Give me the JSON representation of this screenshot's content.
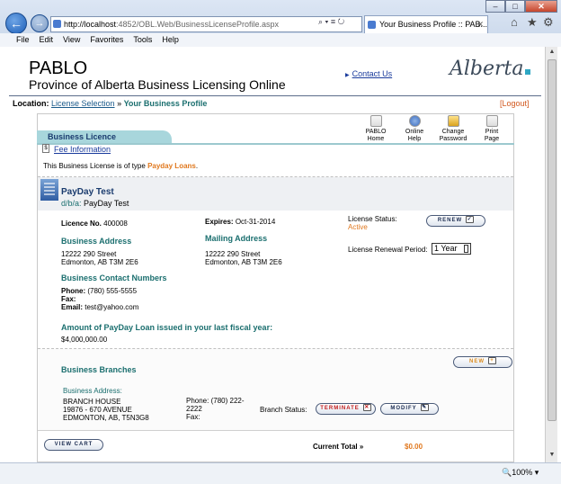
{
  "browser": {
    "title_buttons": [
      "–",
      "□",
      "✕"
    ],
    "back_icon": "back-arrow-icon",
    "forward_icon": "forward-arrow-icon",
    "address_host": "http://localhost",
    "address_rest": ":4852/OBL.Web/BusinessLicenseProfile.aspx",
    "address_tools": "⌕ ▾ ≡ ↻",
    "tab_title": "Your Business Profile :: PAB...",
    "tab_close": "✕",
    "toolbar_icons": [
      "⌂",
      "★",
      "⚙"
    ],
    "menu": [
      "File",
      "Edit",
      "View",
      "Favorites",
      "Tools",
      "Help"
    ],
    "zoom": "🔍100%  ▾"
  },
  "header": {
    "app_name": "PABLO",
    "subtitle": "Province of Alberta Business Licensing Online",
    "contact_link": "Contact Us",
    "logo_text": "Alberta"
  },
  "location": {
    "label": "Location:",
    "crumb_link": "License Selection",
    "separator": " » ",
    "current": "Your Business Profile",
    "logout": "[Logout]"
  },
  "toolbar": {
    "items": [
      {
        "label1": "PABLO",
        "label2": "Home"
      },
      {
        "label1": "Online",
        "label2": "Help"
      },
      {
        "label1": "Change",
        "label2": "Password"
      },
      {
        "label1": "Print",
        "label2": "Page"
      }
    ]
  },
  "licence": {
    "tab_label": "Business Licence",
    "fee_link": "Fee Information",
    "type_prefix": "This Business License is of type ",
    "type_value": "Payday Loans",
    "type_suffix": ".",
    "business_name": "PayDay Test",
    "dba_label": "d/b/a:",
    "dba_value": "PayDay Test",
    "licence_no_label": "Licence No.",
    "licence_no": "400008",
    "expires_label": "Expires:",
    "expires": "Oct-31-2014",
    "status_label": "License Status:",
    "status_value": "Active",
    "renew_button": "RENEW",
    "renewal_period_label": "License Renewal Period:",
    "renewal_period_value": "1 Year",
    "business_address_heading": "Business Address",
    "business_address_line1": "12222 290 Street",
    "business_address_line2": "Edmonton, AB T3M 2E6",
    "mailing_address_heading": "Mailing Address",
    "mailing_address_line1": "12222 290 Street",
    "mailing_address_line2": "Edmonton, AB T3M 2E6",
    "contact_heading": "Business Contact Numbers",
    "phone_label": "Phone:",
    "phone": "(780) 555-5555",
    "fax_label": "Fax:",
    "fax": "",
    "email_label": "Email:",
    "email": "test@yahoo.com",
    "loan_heading": "Amount of PayDay Loan issued in your last fiscal year:",
    "loan_amount": "$4,000,000.00"
  },
  "branches": {
    "heading": "Business Branches",
    "new_button": "NEW",
    "address_label": "Business Address:",
    "name": "BRANCH HOUSE",
    "line1": "19876 - 670 AVENUE",
    "line2": "EDMONTON, AB, T5N3G8",
    "phone_label": "Phone:",
    "phone_part1": "(780) 222-",
    "phone_part2": "2222",
    "fax_label": "Fax:",
    "status_label": "Branch Status:",
    "terminate_button": "TERMINATE",
    "modify_button": "MODIFY"
  },
  "cart": {
    "view_cart_button": "VIEW CART",
    "total_label": "Current Total »",
    "total_value": "$0.00"
  }
}
